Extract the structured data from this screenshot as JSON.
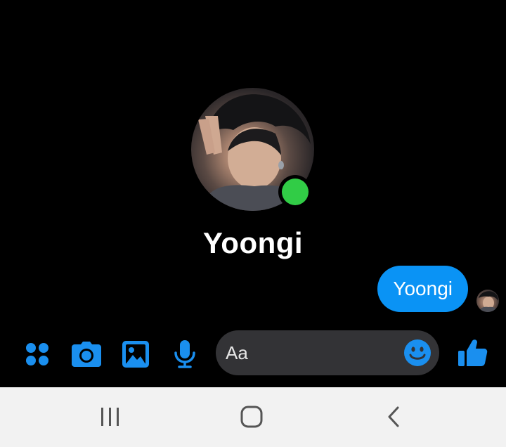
{
  "conversation": {
    "contact_name": "Yoongi",
    "contact_online": true
  },
  "messages": [
    {
      "text": "Yoongi",
      "from": "me"
    }
  ],
  "composer": {
    "placeholder": "Aa",
    "actions": [
      "apps-grid-icon",
      "camera-icon",
      "gallery-icon",
      "microphone-icon"
    ],
    "emoji_icon": "smiley-icon",
    "send_icon": "thumbs-up-icon"
  },
  "navigation": {
    "buttons": [
      "recents-icon",
      "home-icon",
      "back-icon"
    ]
  },
  "colors": {
    "background": "#000000",
    "accent": "#0a93f5",
    "icon_blue": "#1a8fef",
    "online": "#31cc46",
    "input_bg": "#333336",
    "nav_bg": "#f2f2f2",
    "nav_icon": "#555555"
  }
}
